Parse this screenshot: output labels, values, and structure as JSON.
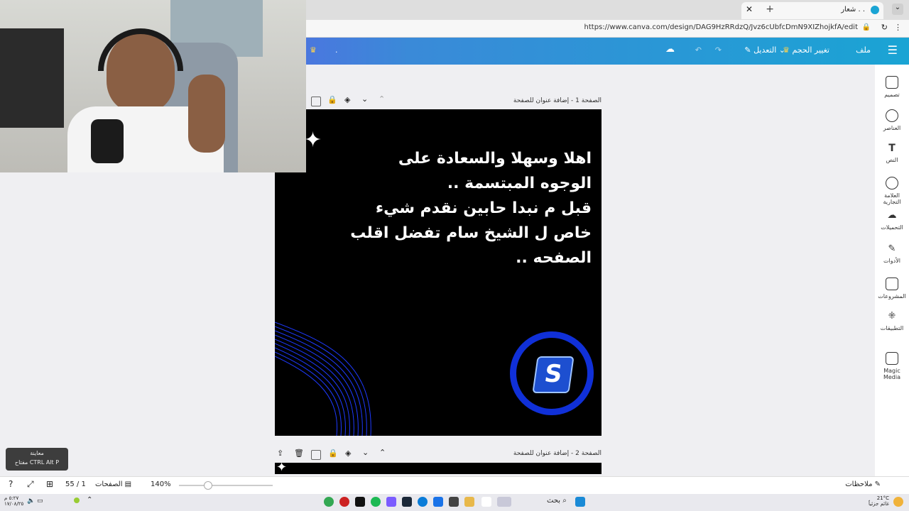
{
  "browser": {
    "tab_title": "شعار . .",
    "url": "https://www.canva.com/design/DAG9HzRRdzQ/Jvz6cUbfcDmN9XIZhojkfA/edit"
  },
  "header": {
    "menu_label": "ملف",
    "resize_label": "تغيير الحجم",
    "edit_label": "التعديل",
    "dot_label": "."
  },
  "rail": {
    "items": [
      {
        "label": "تصميم"
      },
      {
        "label": "العناصر"
      },
      {
        "label": "النص"
      },
      {
        "label": "العلامة التجارية"
      },
      {
        "label": "التحميلات"
      },
      {
        "label": "الأدوات"
      },
      {
        "label": "المشروعات"
      },
      {
        "label": "التطبيقات"
      },
      {
        "label": "Magic Media"
      }
    ]
  },
  "page1": {
    "title": "الصفحة 1 - إضافة عنوان للصفحة",
    "lines": [
      "اهلا وسهلا والسعادة على",
      "الوجوه المبتسمة ..",
      "قبل م نبدا حابين نقدم شيء",
      "خاص ل الشيخ سام تفضل اقلب",
      "الصفحه .."
    ],
    "logo_letter": "S"
  },
  "page2": {
    "title": "الصفحة 2 - إضافة عنوان للصفحة"
  },
  "status": {
    "notes_label": "ملاحظات",
    "pages_label": "الصفحات",
    "page_counter": "55 / 1",
    "zoom": "140%",
    "zoom_fraction": 0.3
  },
  "tooltip": {
    "title": "معاينة",
    "shortcut": "مفتاح CTRL Alt P"
  },
  "taskbar": {
    "search_label": "بحث",
    "weather": "21°C",
    "weather_sub": "غائم جزئياً",
    "time": "٥:٢٧ م",
    "date": "١٧/٠٨/٢٥"
  },
  "colors": {
    "header_start": "#7a3ff2",
    "header_end": "#1aa4d4",
    "logo_ring": "#1030d8"
  }
}
